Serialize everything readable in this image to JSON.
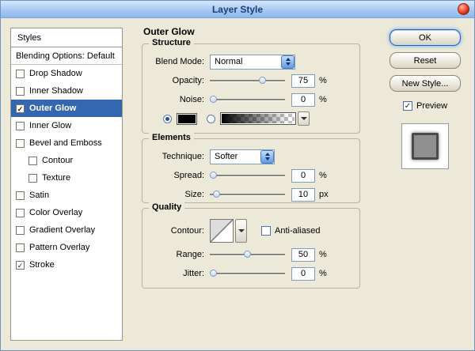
{
  "window": {
    "title": "Layer Style"
  },
  "sidebar": {
    "header": "Styles",
    "items": [
      {
        "label": "Blending Options: Default",
        "checkbox": false,
        "checked": false,
        "indent": false,
        "selected": false,
        "separator": true
      },
      {
        "label": "Drop Shadow",
        "checkbox": true,
        "checked": false,
        "indent": false,
        "selected": false
      },
      {
        "label": "Inner Shadow",
        "checkbox": true,
        "checked": false,
        "indent": false,
        "selected": false
      },
      {
        "label": "Outer Glow",
        "checkbox": true,
        "checked": true,
        "indent": false,
        "selected": true
      },
      {
        "label": "Inner Glow",
        "checkbox": true,
        "checked": false,
        "indent": false,
        "selected": false
      },
      {
        "label": "Bevel and Emboss",
        "checkbox": true,
        "checked": false,
        "indent": false,
        "selected": false
      },
      {
        "label": "Contour",
        "checkbox": true,
        "checked": false,
        "indent": true,
        "selected": false
      },
      {
        "label": "Texture",
        "checkbox": true,
        "checked": false,
        "indent": true,
        "selected": false
      },
      {
        "label": "Satin",
        "checkbox": true,
        "checked": false,
        "indent": false,
        "selected": false
      },
      {
        "label": "Color Overlay",
        "checkbox": true,
        "checked": false,
        "indent": false,
        "selected": false
      },
      {
        "label": "Gradient Overlay",
        "checkbox": true,
        "checked": false,
        "indent": false,
        "selected": false
      },
      {
        "label": "Pattern Overlay",
        "checkbox": true,
        "checked": false,
        "indent": false,
        "selected": false
      },
      {
        "label": "Stroke",
        "checkbox": true,
        "checked": true,
        "indent": false,
        "selected": false
      }
    ]
  },
  "main": {
    "title": "Outer Glow",
    "structure": {
      "title": "Structure",
      "blend_mode": {
        "label": "Blend Mode:",
        "value": "Normal"
      },
      "opacity": {
        "label": "Opacity:",
        "value": "75",
        "unit": "%",
        "percent": 72
      },
      "noise": {
        "label": "Noise:",
        "value": "0",
        "unit": "%",
        "percent": 0
      },
      "color_swatch": "#000000",
      "color_selected": true,
      "gradient_selected": false
    },
    "elements": {
      "title": "Elements",
      "technique": {
        "label": "Technique:",
        "value": "Softer"
      },
      "spread": {
        "label": "Spread:",
        "value": "0",
        "unit": "%",
        "percent": 0
      },
      "size": {
        "label": "Size:",
        "value": "10",
        "unit": "px",
        "percent": 5
      }
    },
    "quality": {
      "title": "Quality",
      "contour": {
        "label": "Contour:"
      },
      "antialiased": {
        "label": "Anti-aliased",
        "checked": false
      },
      "range": {
        "label": "Range:",
        "value": "50",
        "unit": "%",
        "percent": 50
      },
      "jitter": {
        "label": "Jitter:",
        "value": "0",
        "unit": "%",
        "percent": 0
      }
    }
  },
  "actions": {
    "ok": "OK",
    "reset": "Reset",
    "new_style": "New Style...",
    "preview": {
      "label": "Preview",
      "checked": true
    }
  },
  "colors": {
    "selection_blue": "#3567b1",
    "dialog_bg": "#ece9d8",
    "titlebar_blue": "#a9c9f2"
  }
}
